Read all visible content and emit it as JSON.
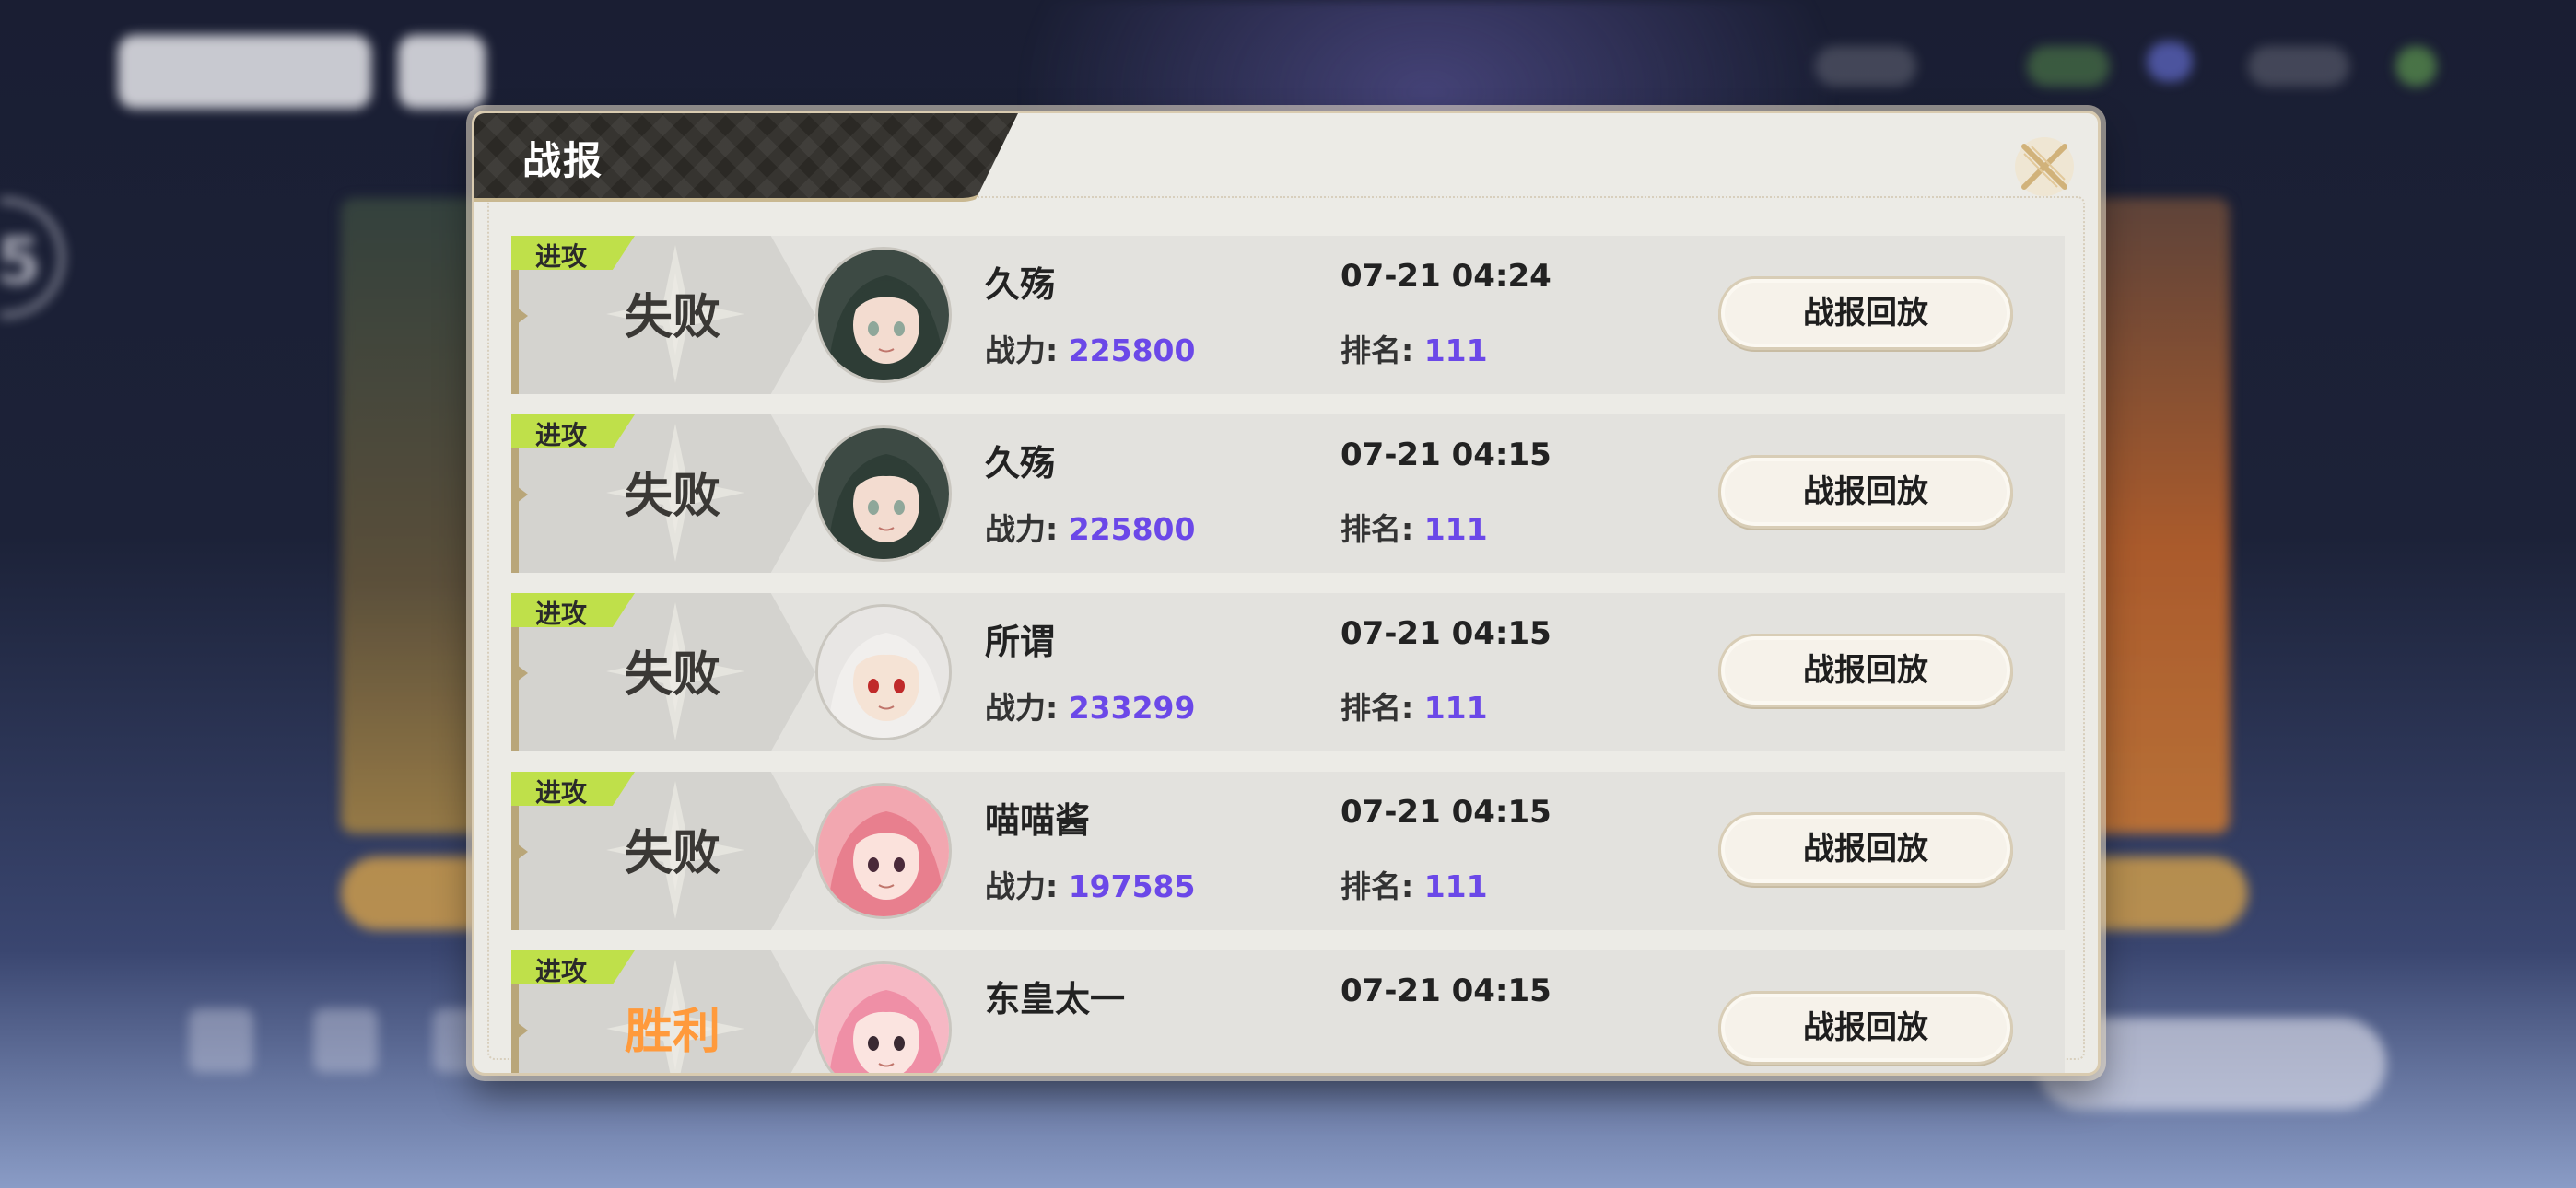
{
  "dialog": {
    "title": "战报",
    "close_icon": "close-x-icon",
    "replay_label": "战报回放",
    "power_label": "战力:",
    "rank_label": "排名:"
  },
  "colors": {
    "accent_purple": "#6b48e8",
    "attack_tag": "#bfe04a",
    "win": "#ff9a3c",
    "lose": "#3a3835"
  },
  "reports": [
    {
      "tag": "进攻",
      "result": "失败",
      "win": false,
      "name": "久殇",
      "power": "225800",
      "time": "07-21 04:24",
      "rank": "111",
      "avatar": "dark-green-hair"
    },
    {
      "tag": "进攻",
      "result": "失败",
      "win": false,
      "name": "久殇",
      "power": "225800",
      "time": "07-21 04:15",
      "rank": "111",
      "avatar": "dark-green-hair"
    },
    {
      "tag": "进攻",
      "result": "失败",
      "win": false,
      "name": "所谓",
      "power": "233299",
      "time": "07-21 04:15",
      "rank": "111",
      "avatar": "white-hair"
    },
    {
      "tag": "进攻",
      "result": "失败",
      "win": false,
      "name": "喵喵酱",
      "power": "197585",
      "time": "07-21 04:15",
      "rank": "111",
      "avatar": "pink-hair"
    },
    {
      "tag": "进攻",
      "result": "胜利",
      "win": true,
      "name": "东皇太一",
      "power": "",
      "time": "07-21 04:15",
      "rank": "",
      "avatar": "pink-hair-bow"
    }
  ]
}
